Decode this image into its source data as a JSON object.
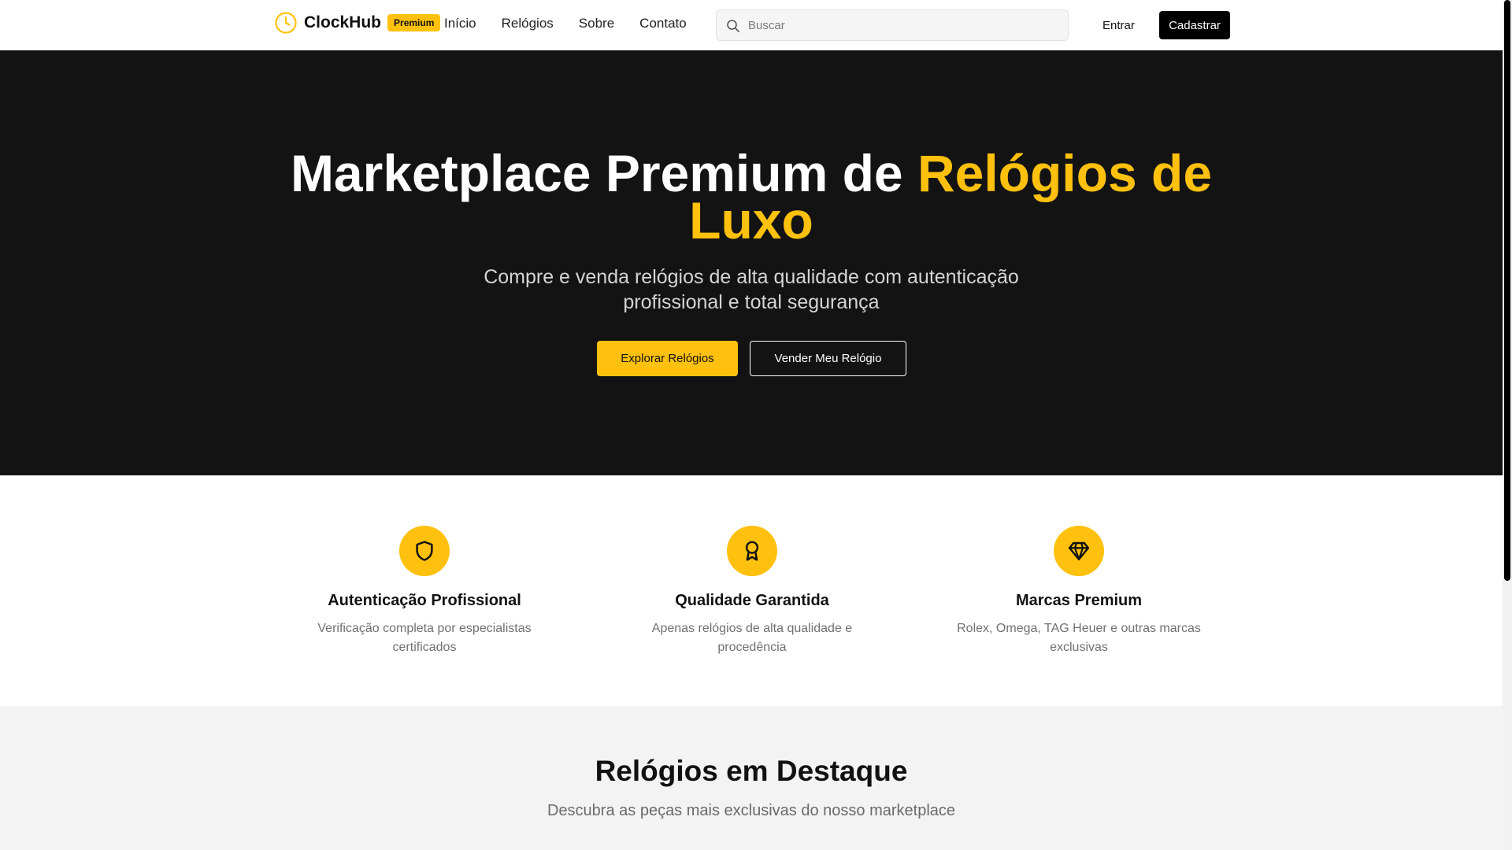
{
  "header": {
    "brand": "ClockHub",
    "badge": "Premium",
    "nav": [
      "Início",
      "Relógios",
      "Sobre",
      "Contato"
    ],
    "search_placeholder": "Buscar",
    "login": "Entrar",
    "signup": "Cadastrar"
  },
  "hero": {
    "title_white": "Marketplace Premium de",
    "title_accent": "Relógios de Luxo",
    "subtitle": "Compre e venda relógios de alta qualidade com autenticação profissional e total segurança",
    "btn_explore": "Explorar Relógios",
    "btn_sell": "Vender Meu Relógio"
  },
  "features": [
    {
      "icon": "shield-icon",
      "title": "Autenticação Profissional",
      "desc": "Verificação completa por especialistas certificados"
    },
    {
      "icon": "award-icon",
      "title": "Qualidade Garantida",
      "desc": "Apenas relógios de alta qualidade e procedência"
    },
    {
      "icon": "diamond-icon",
      "title": "Marcas Premium",
      "desc": "Rolex, Omega, TAG Heuer e outras marcas exclusivas"
    }
  ],
  "featured": {
    "title": "Relógios em Destaque",
    "subtitle": "Descubra as peças mais exclusivas do nosso marketplace"
  },
  "colors": {
    "accent": "#FFC10E",
    "hero_bg": "#131313",
    "featured_bg": "#f3f3f3"
  }
}
